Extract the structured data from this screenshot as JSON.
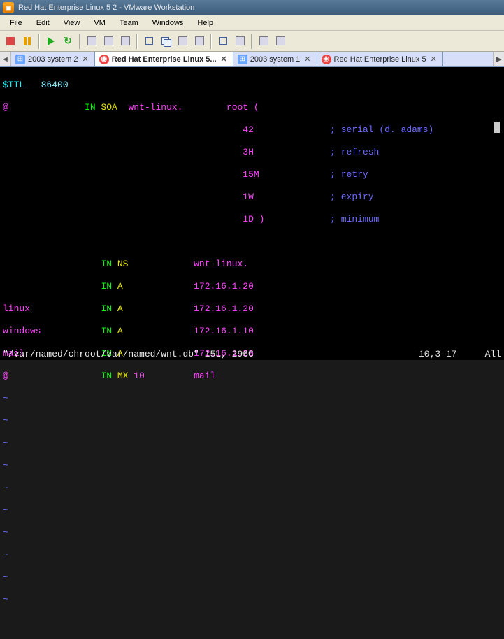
{
  "title": "Red Hat Enterprise Linux 5 2 - VMware Workstation",
  "menus": [
    "File",
    "Edit",
    "View",
    "VM",
    "Team",
    "Windows",
    "Help"
  ],
  "tabs": [
    {
      "label": "2003 system 2",
      "type": "win",
      "active": false
    },
    {
      "label": "Red Hat Enterprise Linux 5...",
      "type": "rh",
      "active": true
    },
    {
      "label": "2003 system 1",
      "type": "win",
      "active": false
    },
    {
      "label": "Red Hat Enterprise Linux 5",
      "type": "rh",
      "active": false
    }
  ],
  "zone": {
    "ttl_directive": "$TTL",
    "ttl_value": "86400",
    "origin": "@",
    "in": "IN",
    "soa": "SOA",
    "primary": "wnt-linux.",
    "contact": "root (",
    "serial": {
      "val": "42",
      "comment": "serial (d. adams)"
    },
    "refresh": {
      "val": "3H",
      "comment": "refresh"
    },
    "retry": {
      "val": "15M",
      "comment": "retry"
    },
    "expiry": {
      "val": "1W",
      "comment": "expiry"
    },
    "minimum": {
      "val": "1D )",
      "comment": "minimum"
    },
    "records": [
      {
        "name": "",
        "type": "NS",
        "prio": "",
        "value": "wnt-linux."
      },
      {
        "name": "",
        "type": "A",
        "prio": "",
        "value": "172.16.1.20"
      },
      {
        "name": "linux",
        "type": "A",
        "prio": "",
        "value": "172.16.1.20"
      },
      {
        "name": "windows",
        "type": "A",
        "prio": "",
        "value": "172.16.1.10"
      },
      {
        "name": "mail",
        "type": "A",
        "prio": "",
        "value": "172.16.1.20"
      },
      {
        "name": "@",
        "type": "MX",
        "prio": "10",
        "value": "mail"
      }
    ],
    "semicolon": ";"
  },
  "status": {
    "file": "\"/var/named/chroot/var/named/wnt.db\" 15L, 296C",
    "pos": "10,3-17",
    "scroll": "All"
  }
}
